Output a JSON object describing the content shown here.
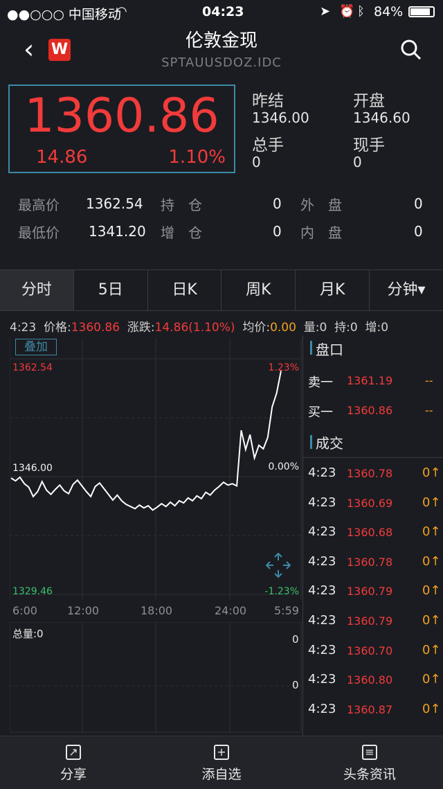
{
  "status_bar": {
    "carrier": "●●○○○ 中国移动",
    "time": "04:23",
    "battery": "84%"
  },
  "header": {
    "title": "伦敦金现",
    "symbol": "SPTAUUSDOZ.IDC",
    "logo_letter": "W"
  },
  "quote": {
    "price": "1360.86",
    "change": "14.86",
    "change_pct": "1.10%",
    "prev_close_label": "昨结",
    "prev_close": "1346.00",
    "open_label": "开盘",
    "open": "1346.60",
    "total_label": "总手",
    "total": "0",
    "current_label": "现手",
    "current": "0"
  },
  "stats": {
    "high_label": "最高价",
    "high": "1362.54",
    "hold_label": "持　仓",
    "hold": "0",
    "outer_label": "外　盘",
    "outer": "0",
    "low_label": "最低价",
    "low": "1341.20",
    "inc_label": "增　仓",
    "inc": "0",
    "inner_label": "内　盘",
    "inner": "0"
  },
  "tabs": [
    "分时",
    "5日",
    "日K",
    "周K",
    "月K",
    "分钟▾"
  ],
  "infobar": {
    "time": "4:23",
    "price_label": "价格:",
    "price": "1360.86",
    "chg_label": "涨跌:",
    "chg": "14.86(1.10%)",
    "avg_label": "均价:",
    "avg": "0.00",
    "vol_label": "量:0",
    "hold_label": "持:0",
    "inc_label": "增:0"
  },
  "chart": {
    "overlay_button": "叠加",
    "y_high": "1362.54",
    "y_mid": "1346.00",
    "y_low": "1329.46",
    "pct_high": "1.23%",
    "pct_mid": "0.00%",
    "pct_low": "-1.23%",
    "x_labels": [
      "6:00",
      "12:00",
      "18:00",
      "24:00",
      "5:59"
    ],
    "volume_label": "总量:0",
    "vol_axis_top": "0",
    "vol_axis_bottom": "0"
  },
  "chart_data": {
    "type": "line",
    "title": "",
    "xlabel": "",
    "ylabel": "",
    "ylim": [
      1329.46,
      1362.54
    ],
    "x_ticks": [
      "6:00",
      "12:00",
      "18:00",
      "24:00",
      "5:59"
    ],
    "series": [
      {
        "values": [
          1345.8,
          1345.4,
          1345.9,
          1345.0,
          1344.5,
          1343.2,
          1343.9,
          1345.3,
          1344.1,
          1343.5,
          1344.2,
          1344.8,
          1344.0,
          1343.6,
          1344.9,
          1345.5,
          1344.7,
          1343.9,
          1343.2,
          1344.6,
          1345.1,
          1344.3,
          1343.5,
          1342.7,
          1343.4,
          1342.6,
          1342.1,
          1341.8,
          1341.5,
          1342.0,
          1341.6,
          1341.9,
          1341.3,
          1341.7,
          1342.2,
          1341.8,
          1342.4,
          1341.9,
          1342.6,
          1342.3,
          1343.0,
          1342.6,
          1343.3,
          1342.9,
          1343.8,
          1343.4,
          1344.1,
          1344.6,
          1345.2,
          1344.8,
          1345.0,
          1344.7,
          1352.5,
          1349.8,
          1351.9,
          1348.6,
          1350.4,
          1349.9,
          1351.5,
          1355.8,
          1357.7,
          1360.86
        ]
      }
    ]
  },
  "right_panel": {
    "book_title": "盘口",
    "ask_label": "卖一",
    "ask": "1361.19",
    "ask_vol": "--",
    "bid_label": "买一",
    "bid": "1360.86",
    "bid_vol": "--",
    "trades_title": "成交",
    "trades": [
      {
        "time": "4:23",
        "price": "1360.78",
        "vol": "0↑"
      },
      {
        "time": "4:23",
        "price": "1360.69",
        "vol": "0↑"
      },
      {
        "time": "4:23",
        "price": "1360.68",
        "vol": "0↑"
      },
      {
        "time": "4:23",
        "price": "1360.78",
        "vol": "0↑"
      },
      {
        "time": "4:23",
        "price": "1360.79",
        "vol": "0↑"
      },
      {
        "time": "4:23",
        "price": "1360.79",
        "vol": "0↑"
      },
      {
        "time": "4:23",
        "price": "1360.70",
        "vol": "0↑"
      },
      {
        "time": "4:23",
        "price": "1360.80",
        "vol": "0↑"
      },
      {
        "time": "4:23",
        "price": "1360.87",
        "vol": "0↑"
      }
    ]
  },
  "bottom_bar": {
    "share": "分享",
    "add_watch": "添自选",
    "third": "头条资讯"
  },
  "colors": {
    "up": "#f23b3b",
    "down": "#39c16b",
    "accent": "#3c8aa7",
    "volume": "#f0a020"
  }
}
